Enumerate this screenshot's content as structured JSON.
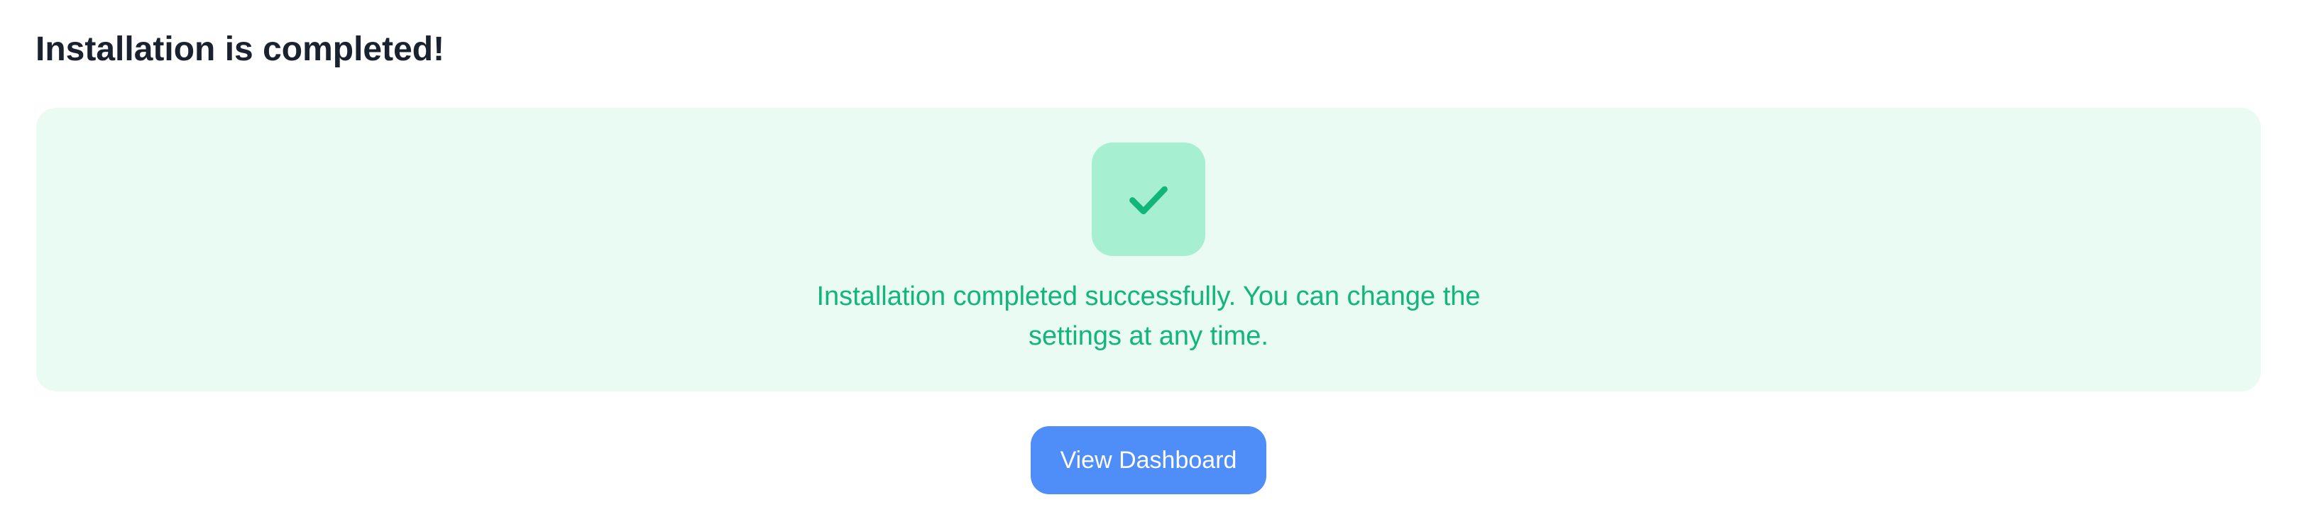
{
  "page": {
    "title": "Installation is completed!"
  },
  "status": {
    "icon": "check-icon",
    "message": "Installation completed successfully. You can change the settings at any time.",
    "colors": {
      "panel_background": "#e9fbf2",
      "badge_background": "#a6f0d1",
      "accent": "#12b57a"
    }
  },
  "actions": {
    "view_dashboard_label": "View Dashboard",
    "button_color": "#4f8df9"
  }
}
